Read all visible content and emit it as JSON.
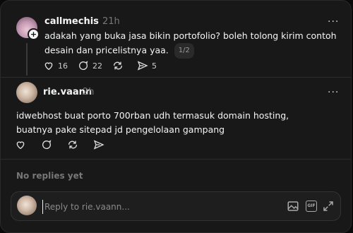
{
  "original_post": {
    "username": "callmechis",
    "time": "21h",
    "text": "adakah yang buka jasa bikin portofolio? boleh tolong kirim contoh desain dan pricelistnya yaa.",
    "pager": "1/2",
    "like_count": "16",
    "reply_count": "22",
    "share_count": "5",
    "more": "···"
  },
  "reply_post": {
    "username": "rie.vaann",
    "time": "2h",
    "text": "idwebhost buat porto 700rban udh termasuk domain hosting, buatnya pake sitepad jd pengelolaan gampang",
    "more": "···"
  },
  "no_replies": "No replies yet",
  "reply_box": {
    "placeholder": "Reply to rie.vaann...",
    "gif": "GIF"
  }
}
